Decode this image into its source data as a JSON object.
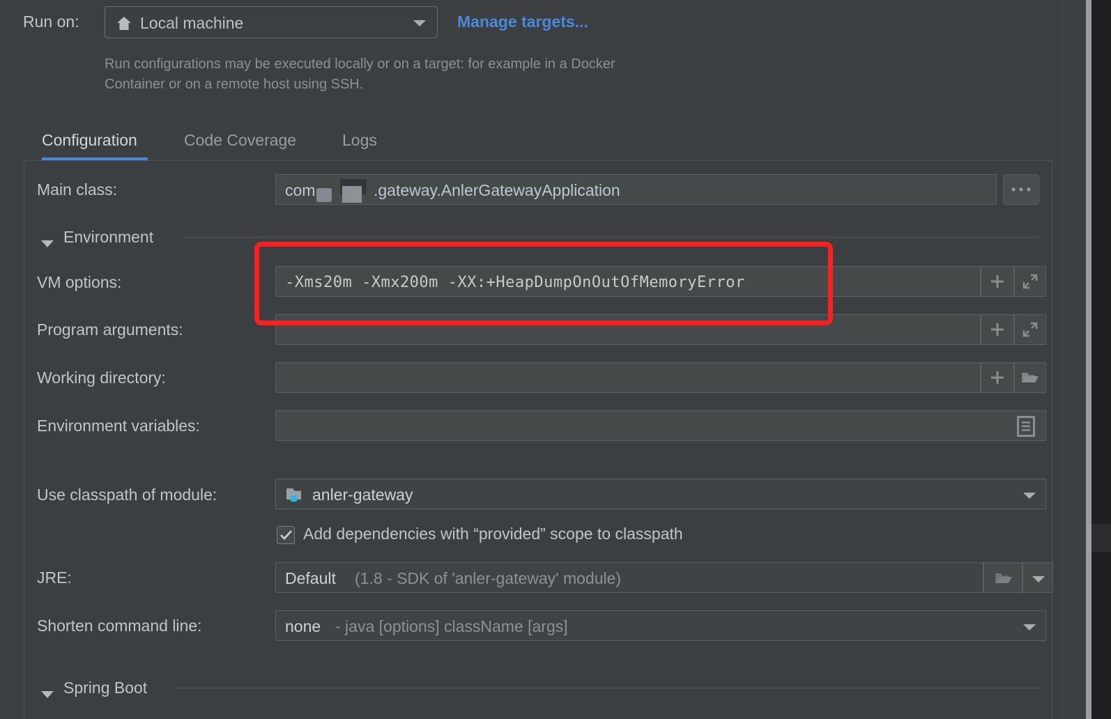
{
  "window": {
    "theme_bg": "#3c3f41",
    "accent": "#4a88d8",
    "annotation_color": "#fb1f1f"
  },
  "run_on": {
    "label": "Run on:",
    "selected_target": "Local machine",
    "target_icon": "home-icon",
    "manage_link": "Manage targets...",
    "description": "Run configurations may be executed locally or on a target: for example in a Docker Container or on a remote host using SSH."
  },
  "tabs": [
    {
      "label": "Configuration",
      "active": true
    },
    {
      "label": "Code Coverage",
      "active": false
    },
    {
      "label": "Logs",
      "active": false
    }
  ],
  "form": {
    "main_class": {
      "label": "Main class:",
      "value_prefix": "com",
      "value_suffix": ".gateway.AnlerGatewayApplication",
      "browse_button": "...",
      "redacted": true
    },
    "environment_section": {
      "label": "Environment",
      "expanded": true
    },
    "vm_options": {
      "label": "VM options:",
      "value": "-Xms20m  -Xmx200m  -XX:+HeapDumpOnOutOfMemoryError",
      "add_icon": "plus-icon",
      "expand_icon": "expand-arrows-icon"
    },
    "program_arguments": {
      "label": "Program arguments:",
      "value": "",
      "add_icon": "plus-icon",
      "expand_icon": "expand-arrows-icon"
    },
    "working_directory": {
      "label": "Working directory:",
      "value": "",
      "add_icon": "plus-icon",
      "browse_icon": "folder-icon"
    },
    "environment_variables": {
      "label": "Environment variables:",
      "value": "",
      "browse_icon": "document-list-icon"
    },
    "classpath_module": {
      "label": "Use classpath of module:",
      "value": "anler-gateway",
      "icon": "module-folder-icon"
    },
    "provided_scope": {
      "label": "Add dependencies with “provided” scope to classpath",
      "checked": true
    },
    "jre": {
      "label": "JRE:",
      "value_primary": "Default",
      "value_secondary": "(1.8 - SDK of 'anler-gateway' module)",
      "browse_icon": "folder-icon"
    },
    "shorten_command_line": {
      "label": "Shorten command line:",
      "value_primary": "none",
      "value_secondary": "- java [options] className [args]"
    },
    "spring_boot_section": {
      "label": "Spring Boot",
      "expanded": true
    }
  },
  "annotation": {
    "type": "red-rectangle-highlight",
    "target": "vm-options-field"
  }
}
